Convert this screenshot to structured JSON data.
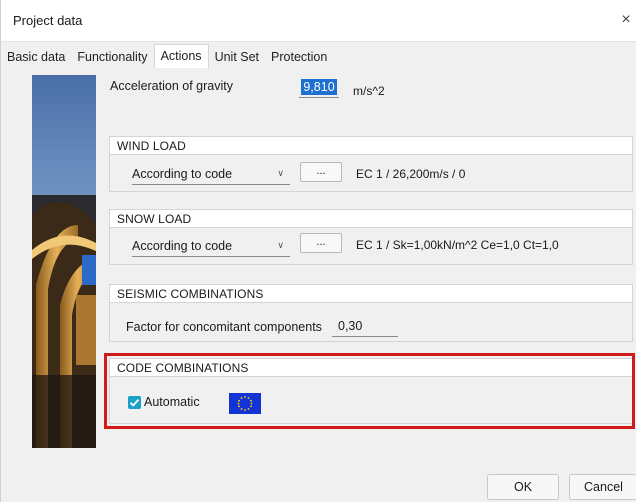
{
  "window": {
    "title": "Project data",
    "close_glyph": "×"
  },
  "tabs": [
    {
      "label": "Basic data"
    },
    {
      "label": "Functionality"
    },
    {
      "label": "Actions"
    },
    {
      "label": "Unit Set"
    },
    {
      "label": "Protection"
    }
  ],
  "active_tab": "Actions",
  "gravity": {
    "label": "Acceleration of gravity",
    "value": "9,810",
    "unit": "m/s^2"
  },
  "wind": {
    "header": "WIND LOAD",
    "mode": "According to code",
    "dots": "...",
    "code": "EC 1 / 26,200m/s / 0"
  },
  "snow": {
    "header": "SNOW LOAD",
    "mode": "According to code",
    "dots": "...",
    "code": "EC 1 / Sk=1,00kN/m^2 Ce=1,0 Ct=1,0"
  },
  "seismic": {
    "header": "SEISMIC COMBINATIONS",
    "factor_label": "Factor for concomitant components",
    "factor_value": "0,30"
  },
  "code_combinations": {
    "header": "CODE COMBINATIONS",
    "automatic_label": "Automatic",
    "automatic_checked": true,
    "flag_icon": "eu-flag-icon"
  },
  "buttons": {
    "ok": "OK",
    "cancel": "Cancel"
  },
  "colors": {
    "highlight": "#d21a1a",
    "selection": "#1e6fd0",
    "checkbox": "#1ba1c8",
    "eu_flag": "#1433d6"
  }
}
